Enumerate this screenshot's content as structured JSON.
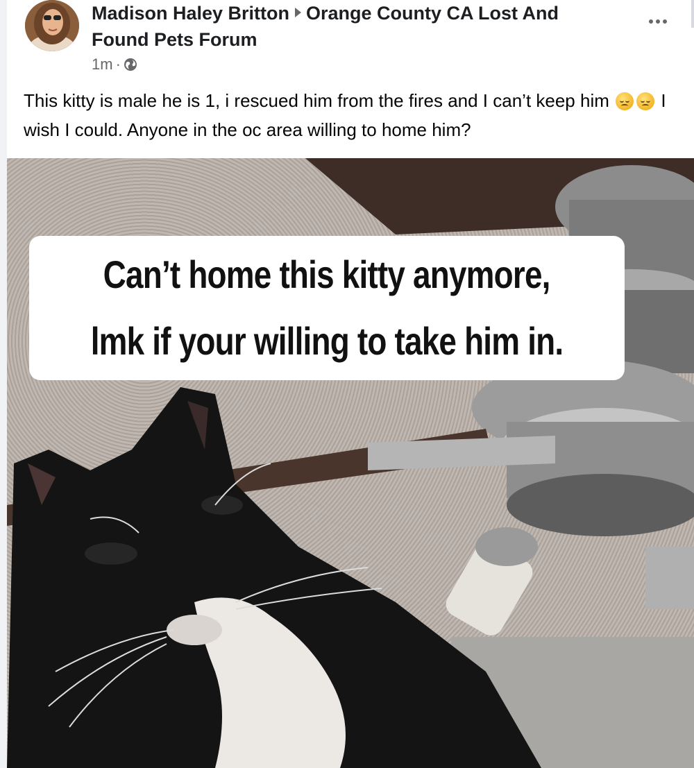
{
  "post": {
    "author": "Madison Haley Britton",
    "group": "Orange County CA Lost And Found Pets Forum",
    "timestamp": "1m",
    "separator": "·",
    "audience_icon": "globe-icon",
    "menu_icon": "more-options-icon",
    "text_part1": "This kitty is male he is 1, i rescued him from the fires and I can’t keep him",
    "emoji": "disappointed-face",
    "text_part2": "I wish I could. Anyone in the oc area willing to home him?"
  },
  "photo": {
    "caption_line1": "Can’t home this kitty anymore,",
    "caption_line2": "lmk if your willing to take him in."
  },
  "colors": {
    "text": "#050505",
    "secondary_text": "#65676b",
    "background": "#ffffff"
  }
}
